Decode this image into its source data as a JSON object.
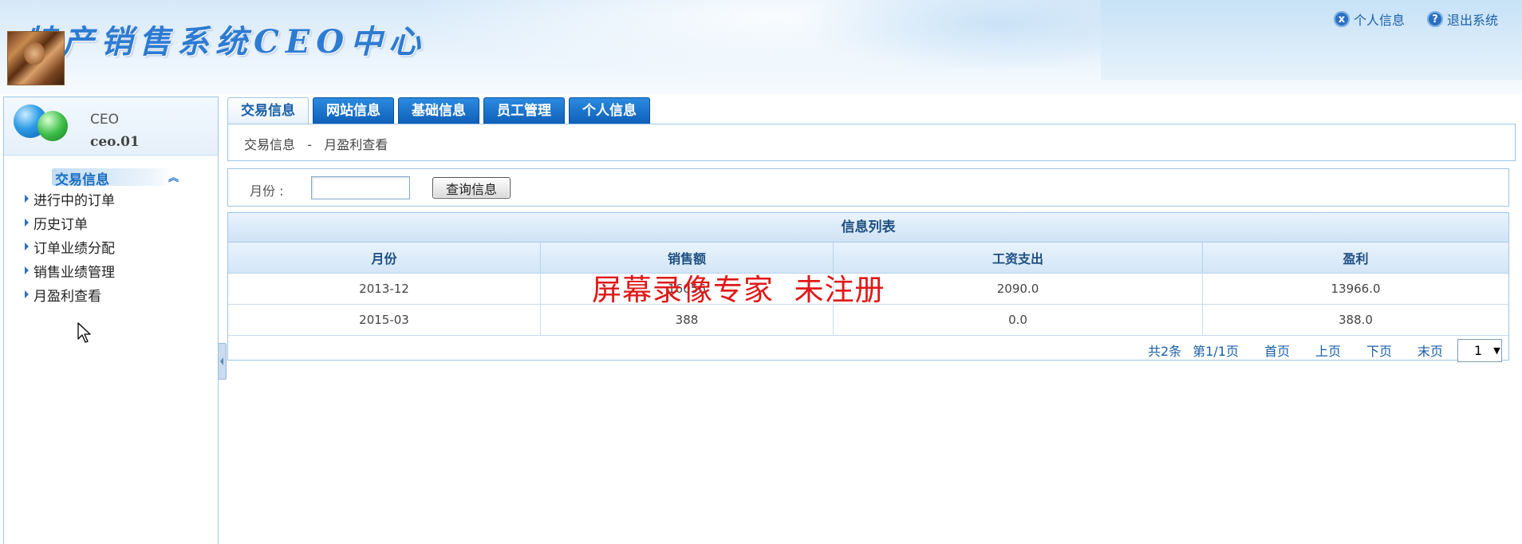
{
  "header": {
    "logo_text": "特产销售系统CEO中心",
    "links": [
      {
        "label": "个人信息",
        "icon": "x"
      },
      {
        "label": "退出系统",
        "icon": "?"
      }
    ]
  },
  "sidebar": {
    "role": "CEO",
    "username": "ceo.01",
    "menu_title": "交易信息",
    "collapse_icon": "chevron-double-up-icon",
    "items": [
      {
        "label": "进行中的订单"
      },
      {
        "label": "历史订单"
      },
      {
        "label": "订单业绩分配"
      },
      {
        "label": "销售业绩管理"
      },
      {
        "label": "月盈利查看"
      }
    ]
  },
  "tabs": [
    {
      "label": "交易信息",
      "active": true
    },
    {
      "label": "网站信息"
    },
    {
      "label": "基础信息"
    },
    {
      "label": "员工管理"
    },
    {
      "label": "个人信息"
    }
  ],
  "breadcrumb": "交易信息   -   月盈利查看",
  "search": {
    "label": "月份   :",
    "value": "",
    "button": "查询信息"
  },
  "list": {
    "title": "信息列表",
    "columns": [
      "月份",
      "销售额",
      "工资支出",
      "盈利"
    ],
    "rows": [
      [
        "2013-12",
        "16056",
        "2090.0",
        "13966.0"
      ],
      [
        "2015-03",
        "388",
        "0.0",
        "388.0"
      ]
    ]
  },
  "pager": {
    "total": "共2条",
    "page_info": "第1/1页",
    "first": "首页",
    "prev": "上页",
    "next": "下页",
    "last": "末页",
    "selected_page": "1"
  },
  "watermark": "屏幕录像专家  未注册",
  "colors": {
    "tab_blue": "#0f5fb8",
    "link_blue": "#1a5fa8",
    "border": "#9cc6e8",
    "watermark": "#e01818"
  }
}
